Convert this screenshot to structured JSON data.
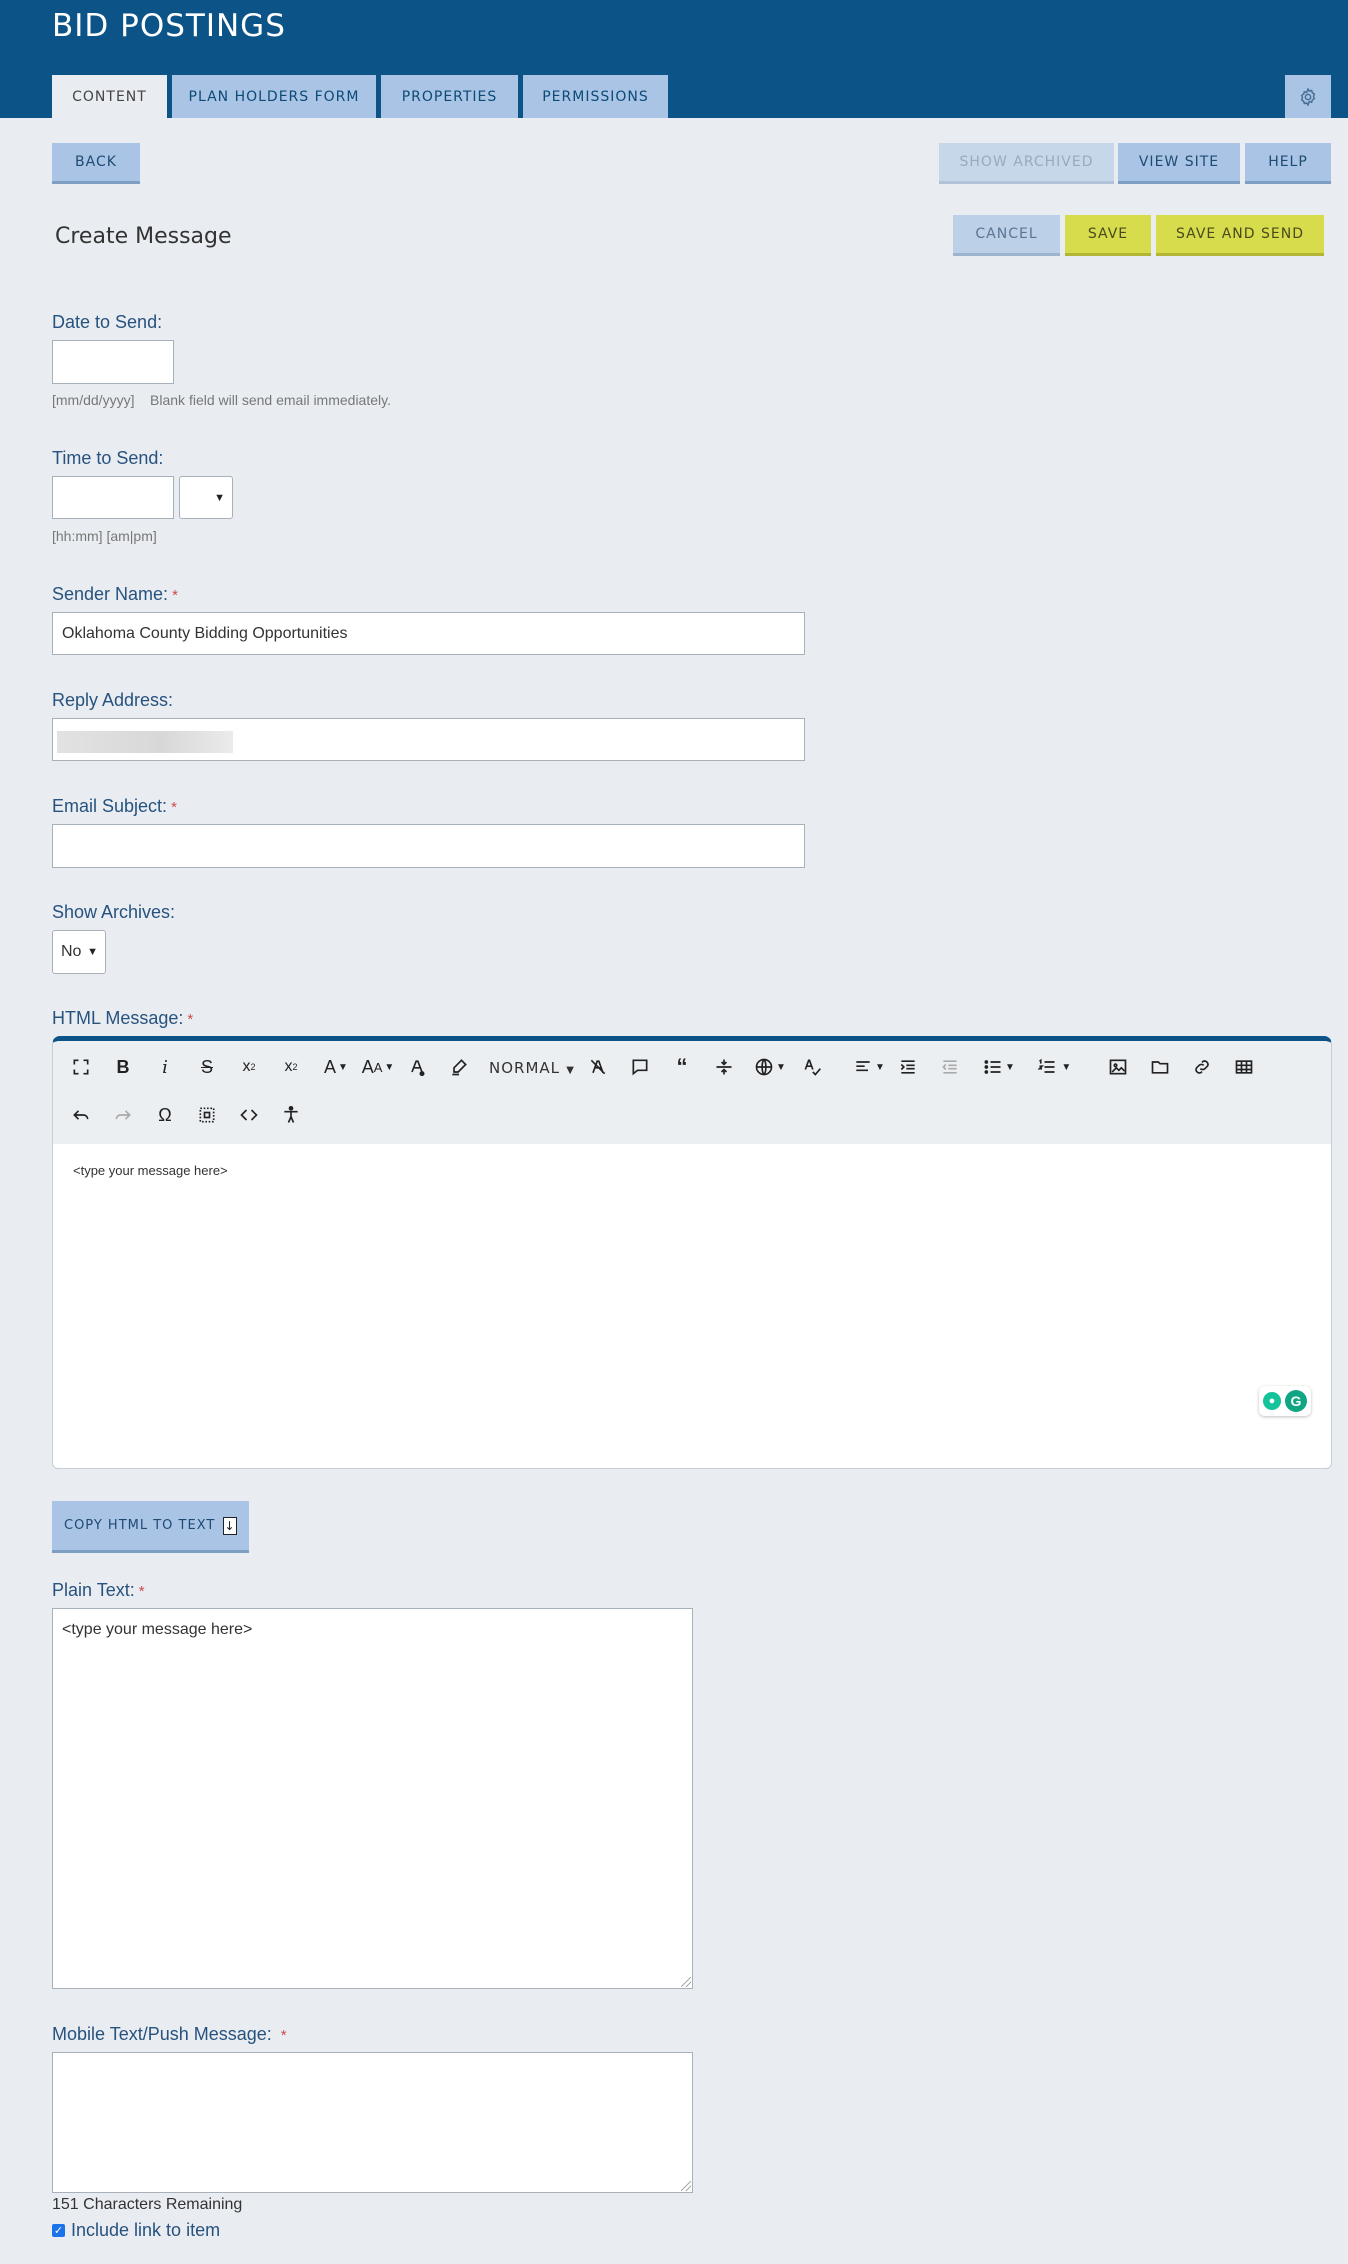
{
  "header": {
    "title": "BID POSTINGS",
    "tabs": [
      {
        "label": "CONTENT",
        "active": true
      },
      {
        "label": "PLAN HOLDERS FORM",
        "active": false
      },
      {
        "label": "PROPERTIES",
        "active": false
      },
      {
        "label": "PERMISSIONS",
        "active": false
      }
    ],
    "settings_icon": "gear-icon"
  },
  "toolbar": {
    "back_label": "BACK",
    "show_archived_label": "SHOW ARCHIVED",
    "view_site_label": "VIEW SITE",
    "help_label": "HELP"
  },
  "page": {
    "heading": "Create Message",
    "cancel_label": "CANCEL",
    "save_label": "SAVE",
    "save_and_send_label": "SAVE AND SEND"
  },
  "form": {
    "date_label": "Date to Send:",
    "date_value": "",
    "date_format_hint": "[mm/dd/yyyy]",
    "date_help": "Blank field will send email immediately.",
    "time_label": "Time to Send:",
    "time_value": "",
    "time_hint": "[hh:mm] [am|pm]",
    "sender_label": "Sender Name:",
    "sender_value": "Oklahoma County Bidding Opportunities",
    "reply_label": "Reply Address:",
    "subject_label": "Email Subject:",
    "subject_value": "",
    "archives_label": "Show Archives:",
    "archives_value": "No",
    "html_label": "HTML Message:",
    "required_mark": "*",
    "editor_format_label": "NORMAL",
    "editor_content": "<type your message here>",
    "copy_button_label": "COPY HTML TO TEXT",
    "plain_label": "Plain Text:",
    "plain_value": "<type your message here>",
    "mobile_label": "Mobile Text/Push Message:",
    "mobile_value": "",
    "remaining_text": "151 Characters Remaining",
    "include_link_label": "Include link to item",
    "include_link_checked": true
  },
  "colors": {
    "header_bg": "#0c5388",
    "tab_bg": "#a9c4e4",
    "accent_yellow": "#d6dc4c",
    "label_color": "#27527e",
    "page_bg": "#e9edf2"
  }
}
